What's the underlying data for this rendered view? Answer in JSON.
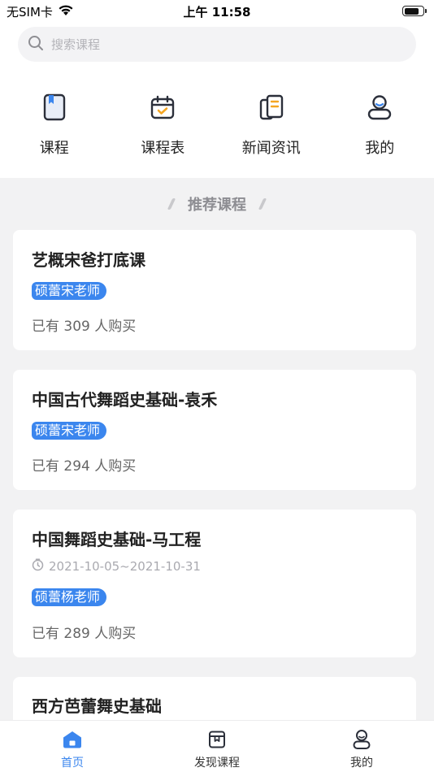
{
  "status_bar": {
    "carrier": "无SIM卡",
    "time": "上午 11:58"
  },
  "search": {
    "placeholder": "搜索课程"
  },
  "quick_nav": [
    {
      "label": "课程",
      "icon": "book-icon"
    },
    {
      "label": "课程表",
      "icon": "calendar-icon"
    },
    {
      "label": "新闻资讯",
      "icon": "news-icon"
    },
    {
      "label": "我的",
      "icon": "user-icon"
    }
  ],
  "section": {
    "title": "推荐课程"
  },
  "courses": [
    {
      "title": "艺概宋爸打底课",
      "teacher": "硕蕾宋老师",
      "buyers": "已有 309 人购买"
    },
    {
      "title": "中国古代舞蹈史基础-袁禾",
      "teacher": "硕蕾宋老师",
      "buyers": "已有 294 人购买"
    },
    {
      "title": "中国舞蹈史基础-马工程",
      "date": "2021-10-05~2021-10-31",
      "teacher": "硕蕾杨老师",
      "buyers": "已有 289 人购买"
    },
    {
      "title": "西方芭蕾舞史基础"
    }
  ],
  "tabs": [
    {
      "label": "首页",
      "icon": "home-icon",
      "active": true
    },
    {
      "label": "发现课程",
      "icon": "discover-box-icon",
      "active": false
    },
    {
      "label": "我的",
      "icon": "profile-icon",
      "active": false
    }
  ],
  "colors": {
    "accent": "#3b86ee",
    "icon_orange": "#f5a623",
    "background": "#f2f2f3"
  }
}
